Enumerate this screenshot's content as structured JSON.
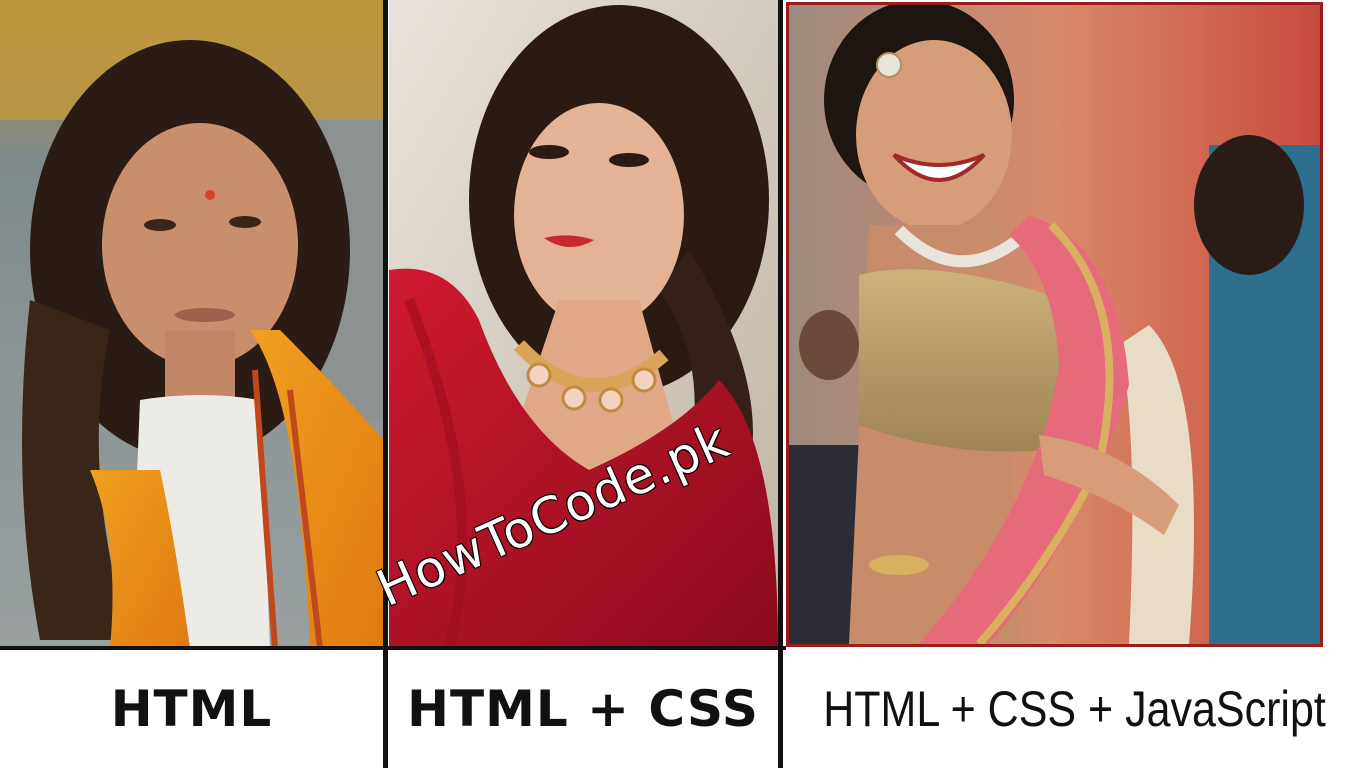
{
  "panels": [
    {
      "caption": "HTML",
      "photo": "plain-look-photo"
    },
    {
      "caption": "HTML + CSS",
      "photo": "styled-look-photo"
    },
    {
      "caption": "HTML + CSS + JavaScript",
      "photo": "animated-look-photo"
    }
  ],
  "watermark": "HowToCode.pk",
  "colors": {
    "divider": "#111111",
    "panel3_border": "#9b1c1c",
    "caption_text": "#111111",
    "background": "#ffffff"
  }
}
